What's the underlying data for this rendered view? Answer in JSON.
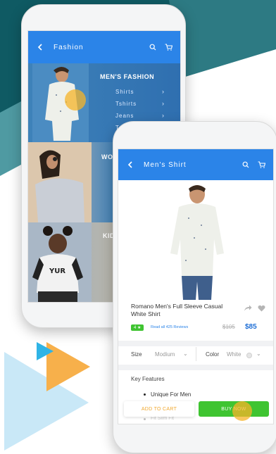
{
  "colors": {
    "teal_dark": "#0f5a63",
    "teal_mid": "#4f9aa2",
    "accent_blue": "#2b84e8",
    "green": "#3fc431",
    "price_blue": "#1f6fd6",
    "tap_orange": "#f5b428"
  },
  "fashion_screen": {
    "header": {
      "title": "Fashion",
      "back_icon": "back-arrow-icon",
      "search_icon": "search-icon",
      "cart_icon": "cart-icon"
    },
    "categories": [
      {
        "title": "MEN'S FASHION",
        "subs": [
          "Shirts",
          "Tshirts",
          "Jeans",
          "Tro"
        ]
      },
      {
        "title": "WO"
      },
      {
        "title": "KID"
      }
    ]
  },
  "product_screen": {
    "header": {
      "title": "Men's Shirt",
      "back_icon": "back-arrow-icon",
      "search_icon": "search-icon",
      "cart_icon": "cart-icon"
    },
    "product": {
      "name": "Romano Men's Full Sleeve Casual White Shirt",
      "rating": "4 ★",
      "reviews_link": "Read all 425 Reviews",
      "old_price": "$105",
      "price": "$85"
    },
    "options": {
      "size_label": "Size",
      "size_value": "Modium",
      "color_label": "Color",
      "color_value": "White"
    },
    "features": {
      "heading": "Key Features",
      "items": [
        "Unique For Men",
        "Fit Slim Fit"
      ]
    },
    "actions": {
      "add_to_cart": "ADD TO CART",
      "buy_now": "BUY NOW"
    }
  }
}
